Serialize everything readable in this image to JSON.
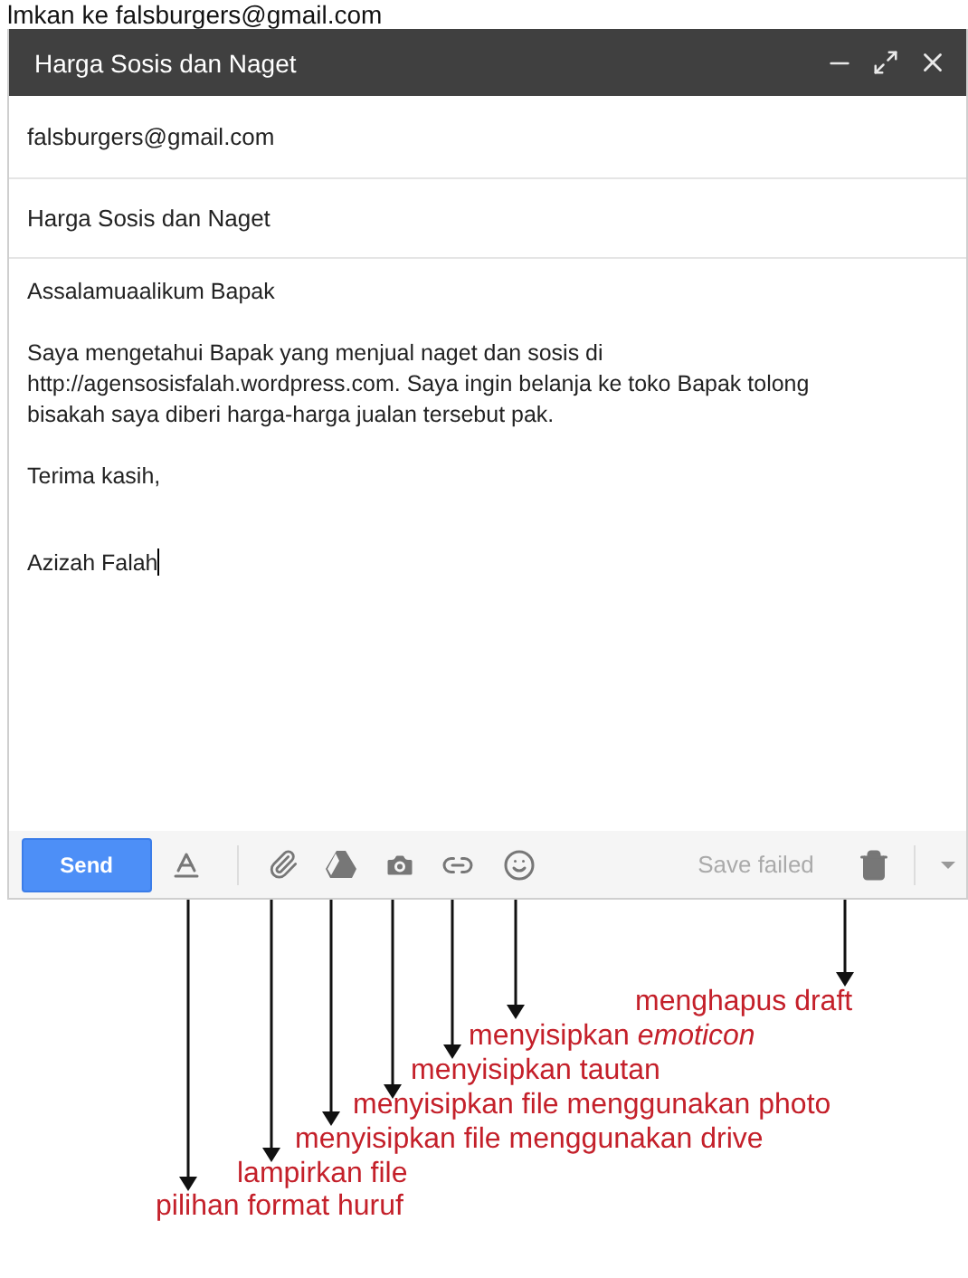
{
  "page_heading": "lmkan ke falsburgers@gmail.com",
  "compose": {
    "title": "Harga Sosis dan Naget",
    "to": "falsburgers@gmail.com",
    "subject": "Harga Sosis dan Naget",
    "body": [
      [
        "Assalamuaalikum Bapak"
      ],
      [
        "Saya mengetahui Bapak yang menjual naget dan sosis di",
        "http://agensosisfalah.wordpress.com. Saya ingin belanja ke toko Bapak tolong",
        "bisakah saya diberi harga-harga jualan tersebut pak."
      ],
      [
        "Terima kasih,"
      ],
      [
        "Azizah Falah"
      ]
    ],
    "send_button": "Send",
    "save_status": "Save failed"
  },
  "annotations": [
    {
      "text": "menghapus draft"
    },
    {
      "text": "menyisipkan *emoticon*"
    },
    {
      "text": "menyisipkan tautan"
    },
    {
      "text": "menyisipkan file menggunakan photo"
    },
    {
      "text": "menyisipkan file menggunakan drive"
    },
    {
      "text": "lampirkan file"
    },
    {
      "text": "pilihan format huruf"
    }
  ]
}
